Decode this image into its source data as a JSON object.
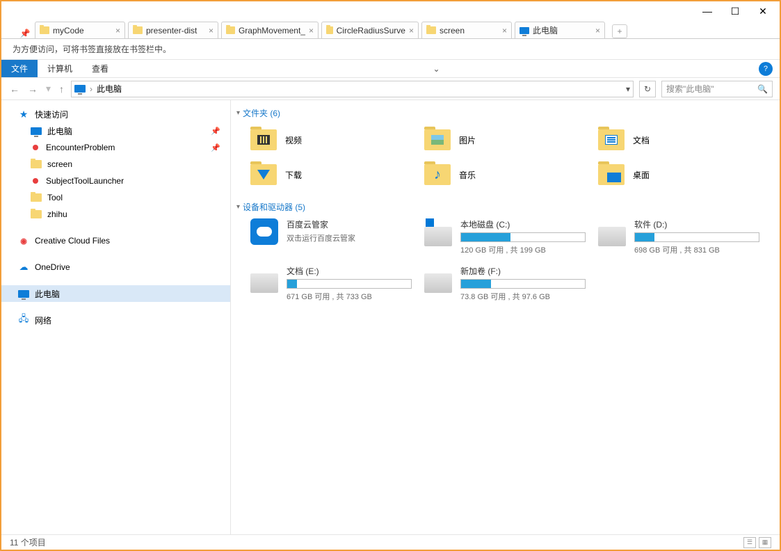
{
  "titlebar": {
    "min": "—",
    "max": "☐",
    "close": "✕"
  },
  "tabs": {
    "items": [
      {
        "label": "myCode"
      },
      {
        "label": "presenter-dist"
      },
      {
        "label": "GraphMovement_"
      },
      {
        "label": "CircleRadiusSurve"
      },
      {
        "label": "screen"
      }
    ],
    "app_tab": "此电脑",
    "newtab": "+"
  },
  "bookmark_hint": "为方便访问，可将书签直接放在书签栏中。",
  "menu": {
    "file": "文件",
    "computer": "计算机",
    "view": "查看",
    "help": "?",
    "chev": "⌄"
  },
  "nav": {
    "back": "←",
    "fwd": "→",
    "up": "↑",
    "crumb": "此电脑",
    "sep": "›",
    "dd": "▾",
    "refresh": "↻",
    "search_placeholder": "搜索\"此电脑\"",
    "mag": "🔍"
  },
  "sidebar": {
    "quick": "快速访问",
    "items": [
      {
        "label": "此电脑",
        "icon": "pc",
        "pin": true
      },
      {
        "label": "EncounterProblem",
        "icon": "red",
        "pin": true
      },
      {
        "label": "screen",
        "icon": "folder"
      },
      {
        "label": "SubjectToolLauncher",
        "icon": "red"
      },
      {
        "label": "Tool",
        "icon": "folder"
      },
      {
        "label": "zhihu",
        "icon": "folder"
      }
    ],
    "cc": "Creative Cloud Files",
    "od": "OneDrive",
    "pc": "此电脑",
    "net": "网络"
  },
  "content": {
    "folders_hdr": "文件夹 (6)",
    "folders": [
      {
        "label": "视频",
        "t": "video"
      },
      {
        "label": "图片",
        "t": "pic"
      },
      {
        "label": "文档",
        "t": "doc"
      },
      {
        "label": "下载",
        "t": "dl"
      },
      {
        "label": "音乐",
        "t": "music"
      },
      {
        "label": "桌面",
        "t": "desk"
      }
    ],
    "drives_hdr": "设备和驱动器 (5)",
    "baidu": {
      "name": "百度云管家",
      "sub": "双击运行百度云管家"
    },
    "drives": [
      {
        "name": "本地磁盘 (C:)",
        "stat": "120 GB 可用 , 共 199 GB",
        "pct": 40,
        "win": true
      },
      {
        "name": "软件 (D:)",
        "stat": "698 GB 可用 , 共 831 GB",
        "pct": 16
      },
      {
        "name": "文档 (E:)",
        "stat": "671 GB 可用 , 共 733 GB",
        "pct": 8
      },
      {
        "name": "新加卷 (F:)",
        "stat": "73.8 GB 可用 , 共 97.6 GB",
        "pct": 24
      }
    ]
  },
  "status": {
    "text": "11 个项目"
  }
}
